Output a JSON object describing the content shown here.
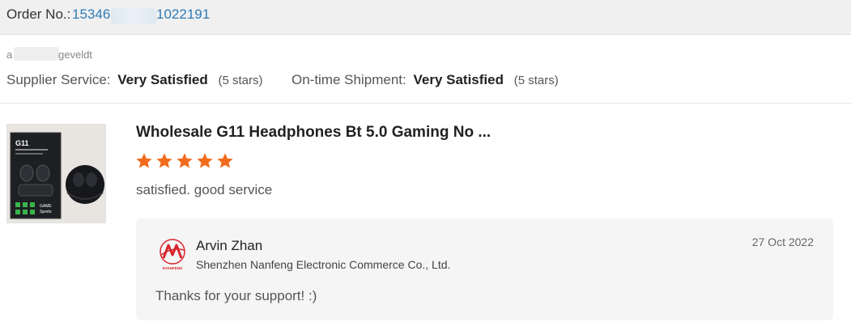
{
  "order": {
    "label": "Order No.: ",
    "number_visible_start": "15346",
    "number_visible_end": "1022191"
  },
  "buyer": {
    "name_start": "a",
    "name_end": "geveldt"
  },
  "ratings": {
    "supplier": {
      "label": "Supplier Service:",
      "value": "Very Satisfied",
      "stars_text": "(5 stars)"
    },
    "shipment": {
      "label": "On-time Shipment:",
      "value": "Very Satisfied",
      "stars_text": "(5 stars)"
    }
  },
  "product": {
    "title": "Wholesale G11 Headphones Bt 5.0 Gaming No ...",
    "stars": 5,
    "image_icon": "earbuds-product-icon",
    "box_label": "G11",
    "box_brand": "GAME Sports"
  },
  "review": {
    "text": "satisfied. good service"
  },
  "reply": {
    "supplier_name": "Arvin Zhan",
    "company": "Shenzhen Nanfeng Electronic Commerce Co., Ltd.",
    "date": "27 Oct 2022",
    "text": "Thanks for your support!  :)",
    "logo_text": "NYANFENG"
  },
  "colors": {
    "order_number": "#2e7bb7",
    "star": "#f26b1d",
    "logo_red": "#d8262c"
  }
}
